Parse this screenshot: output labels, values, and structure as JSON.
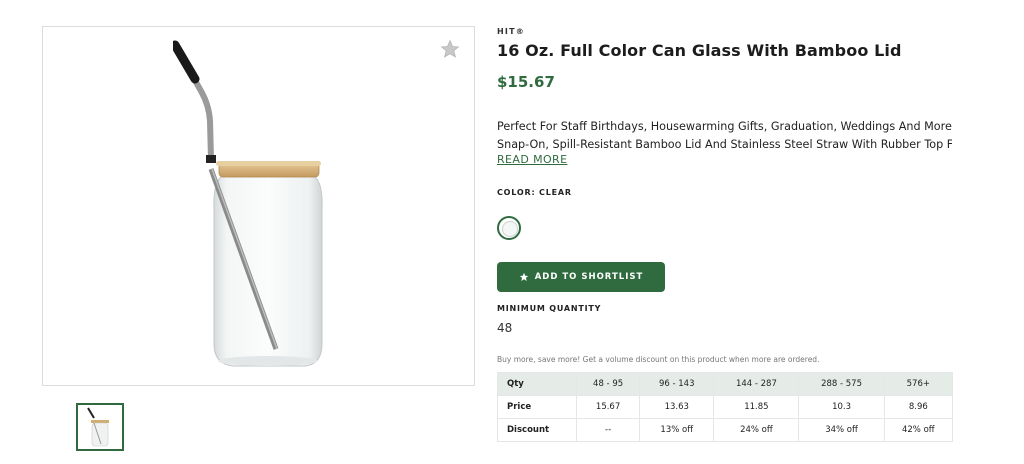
{
  "product": {
    "brand": "HIT®",
    "title": "16 Oz. Full Color Can Glass With Bamboo Lid",
    "price": "$15.67",
    "description_line1": "Perfect For Staff Birthdays, Housewarming Gifts, Graduation, Weddings And More.",
    "description_line2": "Snap-On, Spill-Resistant Bamboo Lid And Stainless Steel Straw With Rubber Top Fo...",
    "read_more": "READ MORE",
    "color_label": "COLOR: CLEAR",
    "add_to_shortlist": "ADD TO SHORTLIST",
    "min_qty_label": "MINIMUM QUANTITY",
    "min_qty_value": "48",
    "volume_note": "Buy more, save more! Get a volume discount on this product when more are ordered."
  },
  "pricing_table": {
    "headers": [
      "Qty",
      "48 - 95",
      "96 - 143",
      "144 - 287",
      "288 - 575",
      "576+"
    ],
    "price_row": [
      "Price",
      "15.67",
      "13.63",
      "11.85",
      "10.3",
      "8.96"
    ],
    "discount_row": [
      "Discount",
      "--",
      "13% off",
      "24% off",
      "34% off",
      "42% off"
    ]
  },
  "colors": {
    "accent_green": "#2f6b3f",
    "table_header_bg": "#e5ece7"
  },
  "icons": {
    "favorite": "star-icon",
    "shortlist": "star-icon"
  }
}
